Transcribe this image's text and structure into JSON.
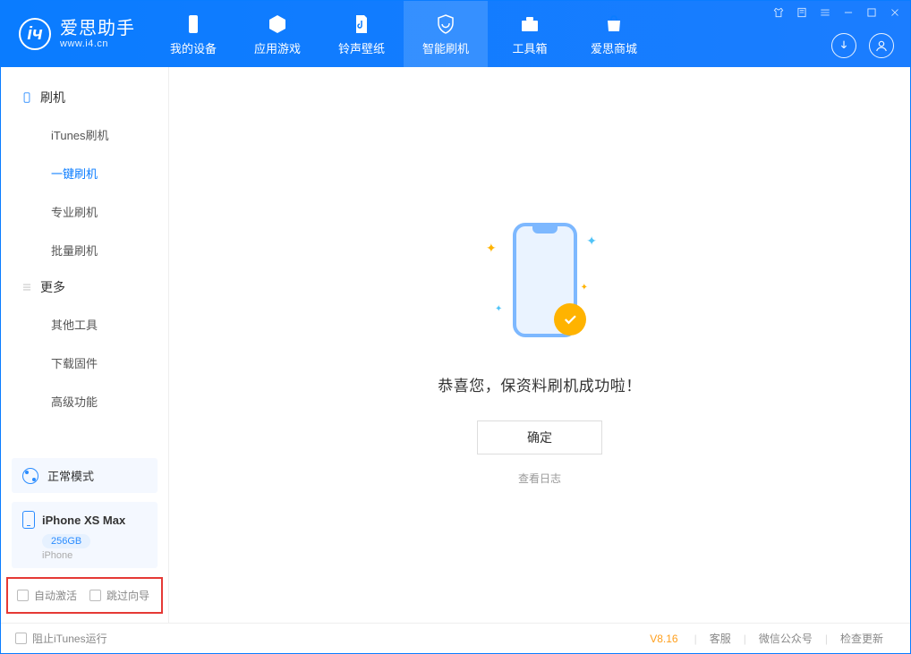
{
  "app": {
    "title": "爱思助手",
    "subtitle": "www.i4.cn"
  },
  "nav": {
    "tabs": [
      {
        "label": "我的设备"
      },
      {
        "label": "应用游戏"
      },
      {
        "label": "铃声壁纸"
      },
      {
        "label": "智能刷机"
      },
      {
        "label": "工具箱"
      },
      {
        "label": "爱思商城"
      }
    ]
  },
  "sidebar": {
    "groups": [
      {
        "title": "刷机",
        "items": [
          "iTunes刷机",
          "一键刷机",
          "专业刷机",
          "批量刷机"
        ]
      },
      {
        "title": "更多",
        "items": [
          "其他工具",
          "下载固件",
          "高级功能"
        ]
      }
    ]
  },
  "device": {
    "mode": "正常模式",
    "name": "iPhone XS Max",
    "capacity": "256GB",
    "type": "iPhone"
  },
  "options": {
    "auto_activate": "自动激活",
    "skip_guide": "跳过向导"
  },
  "main": {
    "success_message": "恭喜您，保资料刷机成功啦！",
    "ok": "确定",
    "view_log": "查看日志"
  },
  "footer": {
    "block_itunes": "阻止iTunes运行",
    "version": "V8.16",
    "links": [
      "客服",
      "微信公众号",
      "检查更新"
    ]
  }
}
